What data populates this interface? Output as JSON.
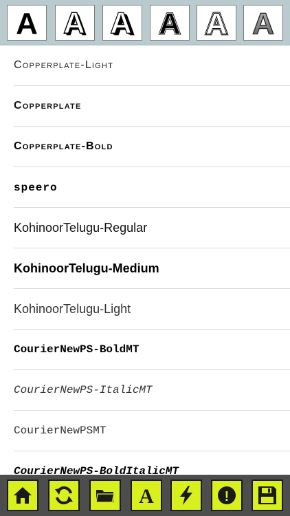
{
  "style_picker": {
    "letter": "A",
    "styles": [
      {
        "name": "plain"
      },
      {
        "name": "shadow"
      },
      {
        "name": "extruded"
      },
      {
        "name": "outline"
      },
      {
        "name": "inline"
      },
      {
        "name": "gradient"
      }
    ]
  },
  "fonts": [
    {
      "label": "Copperplate-Light"
    },
    {
      "label": "Copperplate"
    },
    {
      "label": "Copperplate-Bold"
    },
    {
      "label": "speero"
    },
    {
      "label": "KohinoorTelugu-Regular"
    },
    {
      "label": "KohinoorTelugu-Medium"
    },
    {
      "label": "KohinoorTelugu-Light"
    },
    {
      "label": "CourierNewPS-BoldMT"
    },
    {
      "label": "CourierNewPS-ItalicMT"
    },
    {
      "label": "CourierNewPSMT"
    },
    {
      "label": "CourierNewPS-BoldItalicMT"
    }
  ],
  "toolbar": {
    "buttons": [
      {
        "icon": "home-icon"
      },
      {
        "icon": "refresh-icon"
      },
      {
        "icon": "folder-icon"
      },
      {
        "icon": "font-icon",
        "glyph": "A"
      },
      {
        "icon": "lightning-icon"
      },
      {
        "icon": "alert-icon",
        "glyph": "!"
      },
      {
        "icon": "save-icon"
      }
    ]
  },
  "colors": {
    "picker_background": "#b9cbcf",
    "toolbar_background": "#4d4d4d",
    "button_accent": "#d9ef1e"
  }
}
